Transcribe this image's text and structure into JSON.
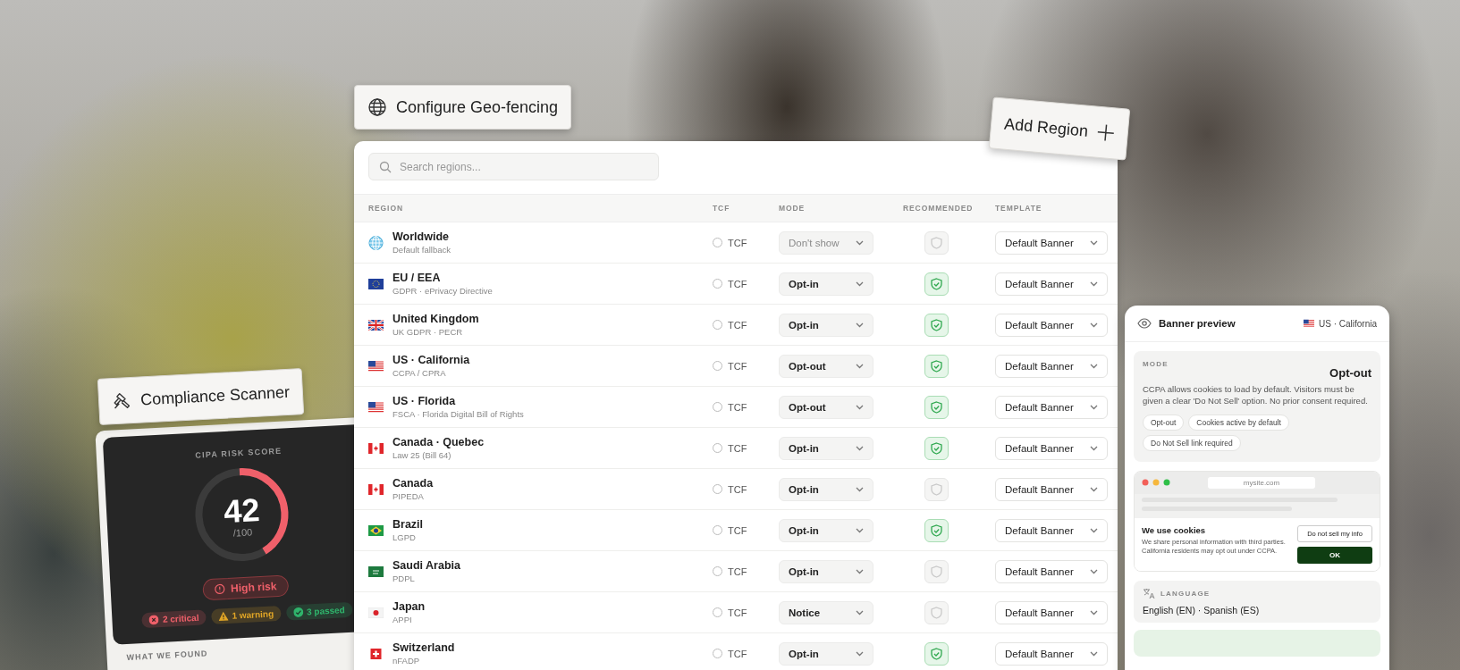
{
  "geo_label": {
    "title": "Configure Geo-fencing"
  },
  "add_button": {
    "label": "Add Region"
  },
  "table": {
    "search": {
      "placeholder": "Search regions..."
    },
    "columns": [
      "REGION",
      "TCF",
      "MODE",
      "RECOMMENDED",
      "TEMPLATE"
    ],
    "rows": [
      {
        "kind": "globe",
        "name": "Worldwide",
        "detail": "Default fallback",
        "tcf_label": "TCF",
        "tcf_checked": false,
        "mode": "Don't show",
        "mode_muted": true,
        "recommended": false,
        "template": "Default Banner"
      },
      {
        "kind": "eu",
        "name": "EU / EEA",
        "detail": "GDPR · ePrivacy Directive",
        "tcf_label": "TCF",
        "tcf_checked": false,
        "mode": "Opt-in",
        "mode_muted": false,
        "recommended": true,
        "template": "Default Banner"
      },
      {
        "kind": "uk",
        "name": "United Kingdom",
        "detail": "UK GDPR · PECR",
        "tcf_label": "TCF",
        "tcf_checked": false,
        "mode": "Opt-in",
        "mode_muted": false,
        "recommended": true,
        "template": "Default Banner"
      },
      {
        "kind": "us",
        "name": "US · California",
        "detail": "CCPA / CPRA",
        "tcf_label": "TCF",
        "tcf_checked": false,
        "mode": "Opt-out",
        "mode_muted": false,
        "recommended": true,
        "template": "Default Banner"
      },
      {
        "kind": "us",
        "name": "US · Florida",
        "detail": "FSCA · Florida Digital Bill of Rights",
        "tcf_label": "TCF",
        "tcf_checked": false,
        "mode": "Opt-out",
        "mode_muted": false,
        "recommended": true,
        "template": "Default Banner"
      },
      {
        "kind": "ca",
        "name": "Canada · Quebec",
        "detail": "Law 25 (Bill 64)",
        "tcf_label": "TCF",
        "tcf_checked": false,
        "mode": "Opt-in",
        "mode_muted": false,
        "recommended": true,
        "template": "Default Banner"
      },
      {
        "kind": "ca",
        "name": "Canada",
        "detail": "PIPEDA",
        "tcf_label": "TCF",
        "tcf_checked": false,
        "mode": "Opt-in",
        "mode_muted": false,
        "recommended": false,
        "template": "Default Banner"
      },
      {
        "kind": "br",
        "name": "Brazil",
        "detail": "LGPD",
        "tcf_label": "TCF",
        "tcf_checked": false,
        "mode": "Opt-in",
        "mode_muted": false,
        "recommended": true,
        "template": "Default Banner"
      },
      {
        "kind": "sa",
        "name": "Saudi Arabia",
        "detail": "PDPL",
        "tcf_label": "TCF",
        "tcf_checked": false,
        "mode": "Opt-in",
        "mode_muted": false,
        "recommended": false,
        "template": "Default Banner"
      },
      {
        "kind": "jp",
        "name": "Japan",
        "detail": "APPI",
        "tcf_label": "TCF",
        "tcf_checked": false,
        "mode": "Notice",
        "mode_muted": false,
        "recommended": false,
        "template": "Default Banner"
      },
      {
        "kind": "ch",
        "name": "Switzerland",
        "detail": "nFADP",
        "tcf_label": "TCF",
        "tcf_checked": false,
        "mode": "Opt-in",
        "mode_muted": false,
        "recommended": true,
        "template": "Default Banner"
      }
    ]
  },
  "scanner": {
    "title": "Compliance Scanner",
    "score_label": "CIPA RISK SCORE",
    "score": "42",
    "score_max": "/100",
    "level": 0.42,
    "risk": "High risk",
    "chips": [
      {
        "kind": "critical",
        "label": "2 critical",
        "color": "#f0606a"
      },
      {
        "kind": "warning",
        "label": "1 warning",
        "color": "#e0a526"
      },
      {
        "kind": "passed",
        "label": "3 passed",
        "color": "#2fb36b"
      }
    ],
    "found_label": "WHAT WE FOUND"
  },
  "preview": {
    "title": "Banner preview",
    "region": {
      "kind": "us",
      "label": "US · California"
    },
    "mode_label": "MODE",
    "mode": "Opt-out",
    "description": "CCPA allows cookies to load by default. Visitors must be given a clear 'Do Not Sell' option. No prior consent required.",
    "tags": [
      "Opt-out",
      "Cookies active by default",
      "Do Not Sell link required"
    ],
    "site": {
      "url": "mysite.com",
      "banner_title": "We use cookies",
      "banner_text": "We share personal information with third parties. California residents may opt out under CCPA.",
      "secondary_button": "Do not sell my info",
      "primary_button": "OK"
    },
    "language_label": "LANGUAGE",
    "languages": "English (EN) · Spanish (ES)"
  }
}
